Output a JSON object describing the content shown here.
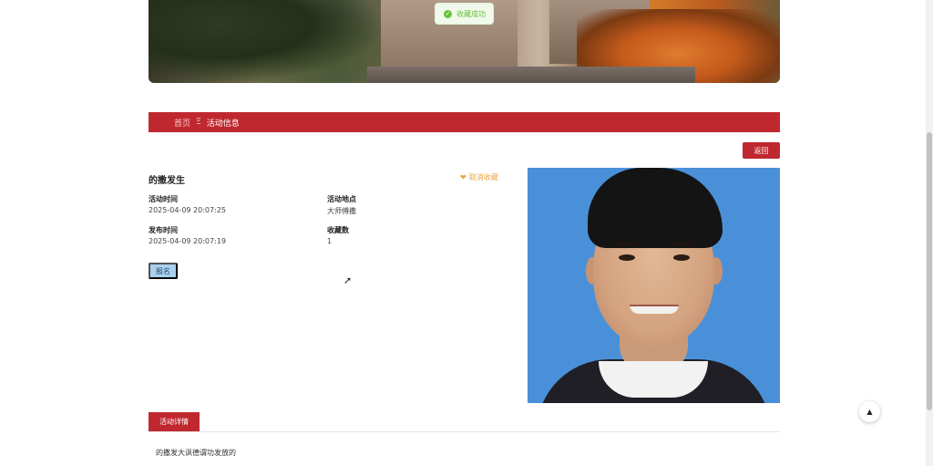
{
  "toast": {
    "text": "收藏成功"
  },
  "breadcrumb": {
    "home": "首页",
    "separator": "Ξ",
    "current": "活动信息"
  },
  "back_button": "返回",
  "activity": {
    "title": "的撒发生",
    "favorite_label": "取消收藏",
    "fields": {
      "time_label": "活动时间",
      "time_value": "2025-04-09 20:07:25",
      "location_label": "活动地点",
      "location_value": "大师傅撒",
      "publish_label": "发布时间",
      "publish_value": "2025-04-09 20:07:19",
      "favcount_label": "收藏数",
      "favcount_value": "1"
    },
    "signup_label": "报名"
  },
  "detail": {
    "tab_label": "活动详情",
    "content": "的撒发大讽德谓功发放的"
  },
  "colors": {
    "primary_red": "#c0282f",
    "toast_green": "#67c23a",
    "favorite_orange": "#f0a33a",
    "signup_blue": "#a9d0ef"
  },
  "icons": {
    "toast": "check-circle-icon",
    "favorite": "heart-icon",
    "scroll_top": "caret-up-icon"
  }
}
